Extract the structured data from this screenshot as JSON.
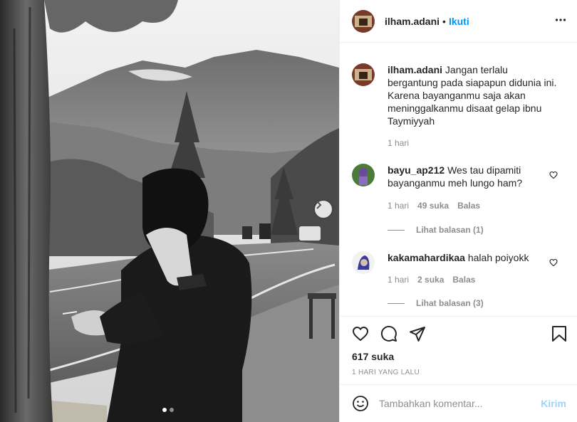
{
  "post": {
    "author": "ilham.adani",
    "separator": "•",
    "follow_label": "Ikuti",
    "more_icon": "more-horizontal-icon"
  },
  "caption": {
    "user": "ilham.adani",
    "text": "Jangan terlalu bergantung pada siapapun didunia ini. Karena bayanganmu saja akan meninggalkanmu disaat gelap ibnu Taymiyyah",
    "time": "1 hari"
  },
  "comments": [
    {
      "user": "bayu_ap212",
      "text": "Wes tau dipamiti bayanganmu meh lungo ham?",
      "time": "1 hari",
      "likes": "49 suka",
      "reply_label": "Balas",
      "view_replies": "Lihat balasan (1)"
    },
    {
      "user": "kakamahardikaa",
      "text": "halah poiyokk",
      "time": "1 hari",
      "likes": "2 suka",
      "reply_label": "Balas",
      "view_replies": "Lihat balasan (3)"
    }
  ],
  "actions": {
    "likes": "617 suka",
    "posted": "1 HARI YANG LALU"
  },
  "add_comment": {
    "placeholder": "Tambahkan komentar...",
    "post_label": "Kirim"
  },
  "carousel": {
    "current": 1,
    "total": 2
  },
  "colors": {
    "link": "#0095f6",
    "muted": "#8e8e8e",
    "text": "#262626",
    "border": "#efefef"
  }
}
